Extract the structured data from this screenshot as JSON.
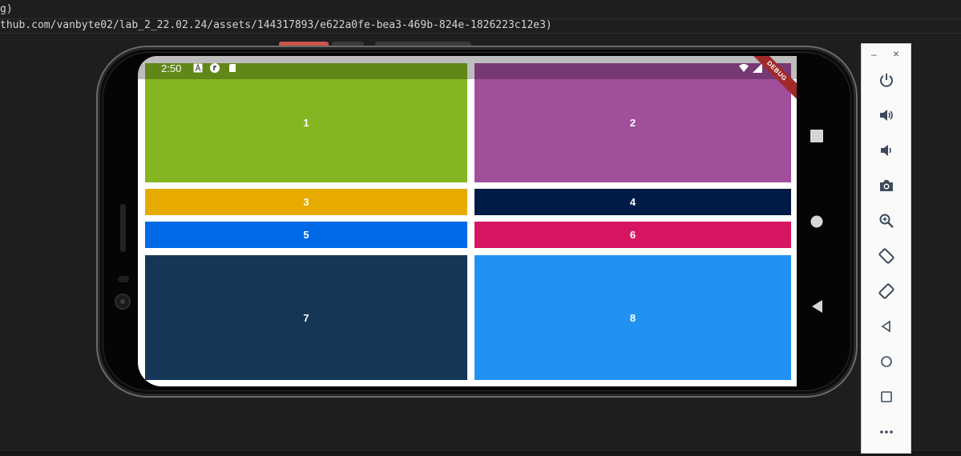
{
  "editor": {
    "line1": "g)",
    "line2": "thub.com/vanbyte02/lab_2_22.02.24/assets/144317893/e622a0fe-bea3-469b-824e-1826223c12e3)"
  },
  "status_bar": {
    "time": "2:50",
    "debug_banner": "DEBUG"
  },
  "tiles": [
    {
      "label": "1",
      "color": "#84b623"
    },
    {
      "label": "2",
      "color": "#a14e9b"
    },
    {
      "label": "3",
      "color": "#e7ab00"
    },
    {
      "label": "4",
      "color": "#001b46"
    },
    {
      "label": "5",
      "color": "#006ae6"
    },
    {
      "label": "6",
      "color": "#d81563"
    },
    {
      "label": "7",
      "color": "#153656"
    },
    {
      "label": "8",
      "color": "#2192f1"
    }
  ],
  "toolbar": {
    "minimize": "–",
    "close": "×",
    "buttons": [
      "power-icon",
      "volume-up-icon",
      "volume-down-icon",
      "camera-icon",
      "zoom-icon",
      "rotate-left-icon",
      "rotate-right-icon",
      "back-icon",
      "home-icon",
      "overview-icon",
      "more-icon"
    ]
  },
  "colors": {
    "editor_bg": "#1e1e1e",
    "toolbar_bg": "#fafafa",
    "toolbar_icon": "#3c4b5c"
  }
}
